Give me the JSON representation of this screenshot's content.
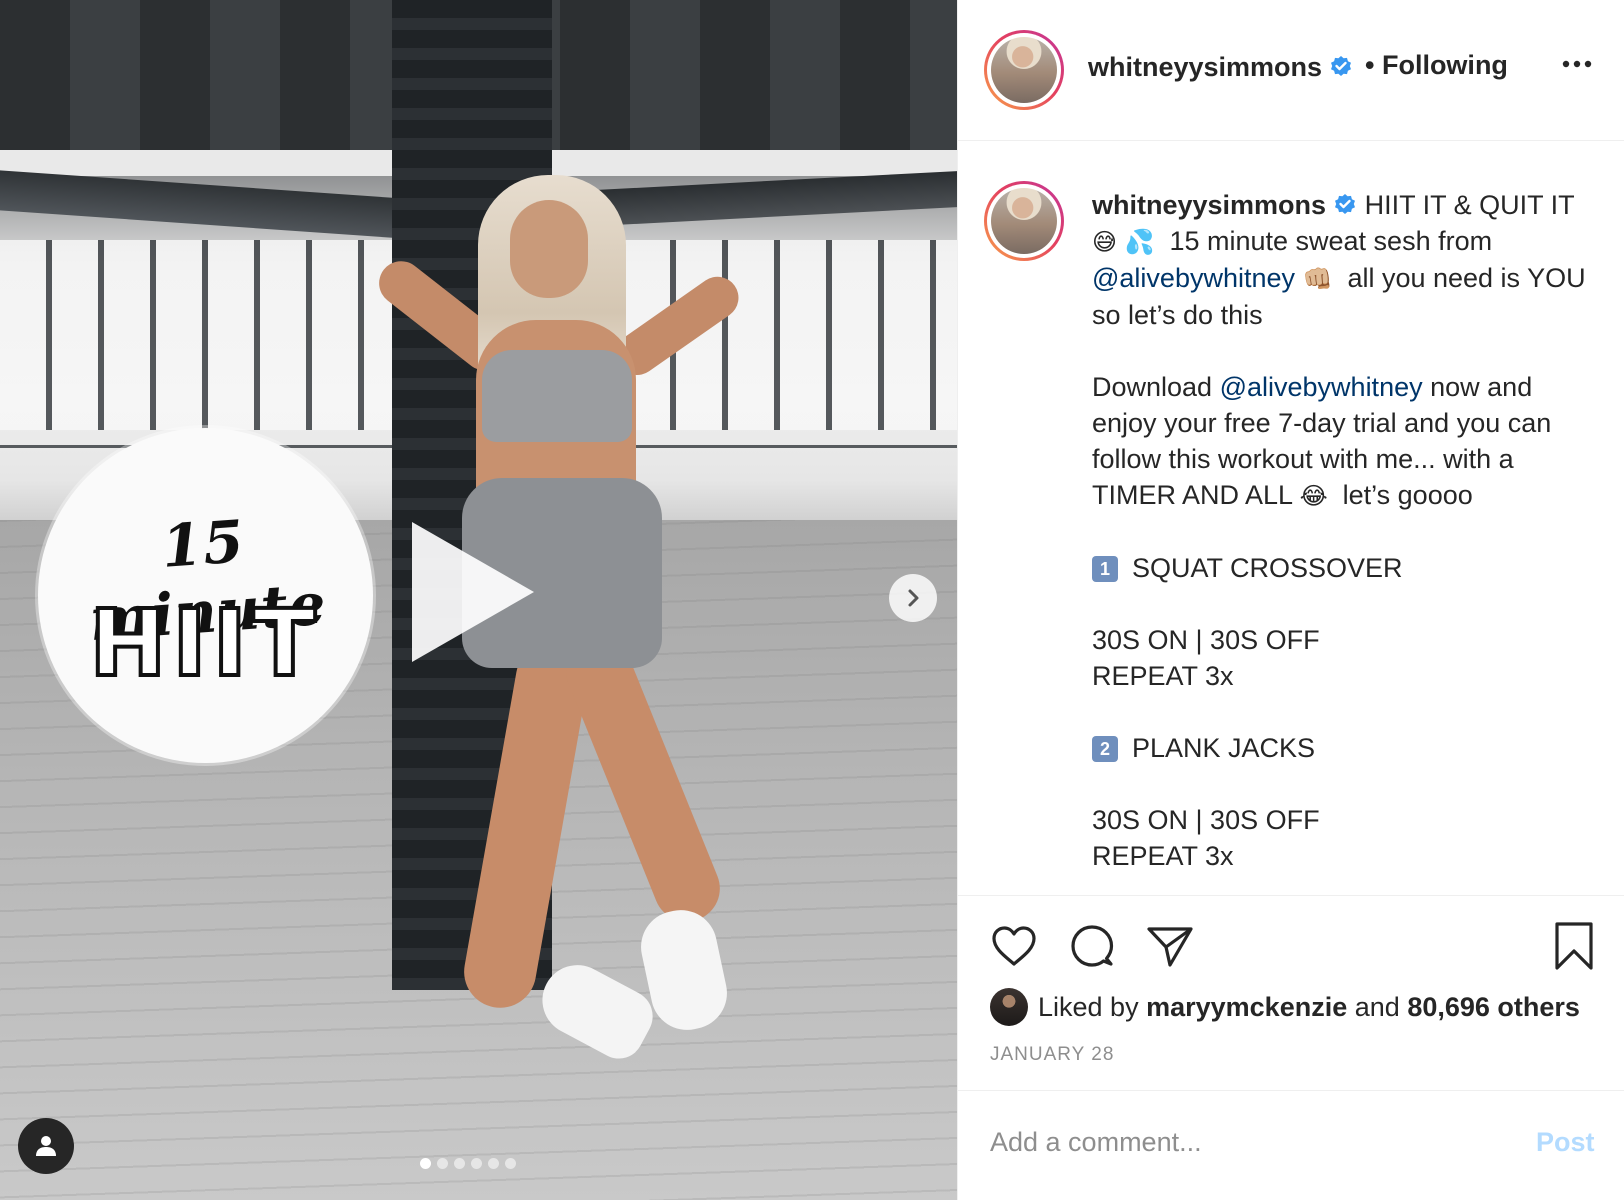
{
  "media": {
    "overlay_script": "15 minute",
    "overlay_block": "HIIT",
    "carousel_dots": 6,
    "active_dot": 1
  },
  "header": {
    "username": "whitneyysimmons",
    "verified": true,
    "follow_state": "• Following",
    "more_icon": "more-horizontal-icon"
  },
  "caption": {
    "username": "whitneyysimmons",
    "line1": "HIIT IT & QUIT IT",
    "emoji1": "😅",
    "emoji2": "💦",
    "line2": "15 minute sweat sesh from",
    "mention1": "@alivebywhitney",
    "emoji3": "👊🏼",
    "line3": "all you need is YOU",
    "line4": "so let’s do this",
    "p2_a": "Download",
    "mention2": "@alivebywhitney",
    "p2_b": "now and enjoy your free 7-day trial and you can follow this workout with me... with a TIMER AND ALL",
    "emoji4": "😂",
    "p2_c": "let’s goooo",
    "step1_key": "1",
    "step1": "SQUAT CROSSOVER",
    "step1_detail_a": "30S ON | 30S OFF",
    "step1_detail_b": "REPEAT 3x",
    "step2_key": "2",
    "step2": "PLANK JACKS",
    "step2_detail_a": "30S ON | 30S OFF",
    "step2_detail_b": "REPEAT 3x"
  },
  "actions": {
    "like_icon": "heart-icon",
    "comment_icon": "comment-icon",
    "share_icon": "paper-plane-icon",
    "save_icon": "bookmark-icon"
  },
  "likes": {
    "prefix": "Liked by",
    "user": "maryymckenzie",
    "joiner": "and",
    "others": "80,696 others"
  },
  "date": "JANUARY 28",
  "comment": {
    "placeholder": "Add a comment...",
    "post_label": "Post"
  },
  "colors": {
    "link": "#003569",
    "verified": "#3897f0",
    "post_disabled": "#b3dbff",
    "muted": "#8e8e8e",
    "text": "#262626"
  }
}
